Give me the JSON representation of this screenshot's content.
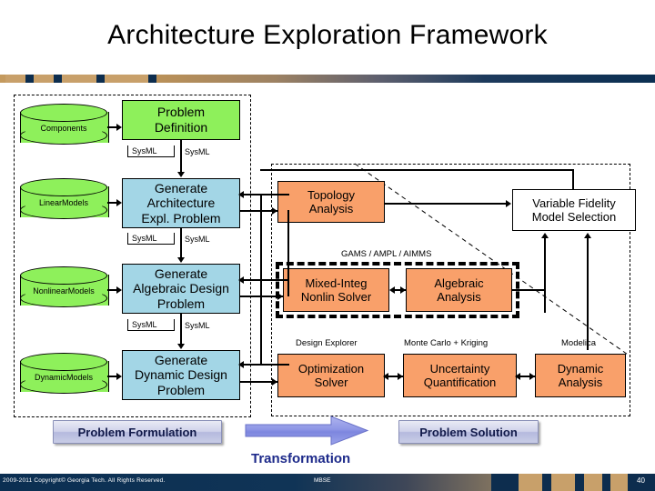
{
  "slide": {
    "title": "Architecture Exploration Framework",
    "footer": {
      "copyright": "2009-2011 Copyright© Georgia Tech. All Rights Reserved.",
      "center": "MBSE",
      "page_number": "40"
    }
  },
  "colors": {
    "green": "#8ef05b",
    "blue": "#a3d6e6",
    "orange": "#f9a06a",
    "white": "#ffffff",
    "navy": "#0d2d4e",
    "tan": "#c8a06a",
    "callout_text": "#121a4a",
    "transformation_text": "#1d2a8a"
  },
  "data_stores": [
    {
      "label": "Components"
    },
    {
      "label": "Linear\nModels",
      "line1": "Linear",
      "line2": "Models"
    },
    {
      "label": "Nonlinear\nModels",
      "line1": "Nonlinear",
      "line2": "Models"
    },
    {
      "label": "Dynamic\nModels",
      "line1": "Dynamic",
      "line2": "Models"
    }
  ],
  "formulation": {
    "problem_definition": {
      "line1": "Problem",
      "line2": "Definition"
    },
    "generate_architecture": {
      "line1": "Generate",
      "line2": "Architecture",
      "line3": "Expl. Problem"
    },
    "generate_algebraic": {
      "line1": "Generate",
      "line2": "Algebraic Design",
      "line3": "Problem"
    },
    "generate_dynamic": {
      "line1": "Generate",
      "line2": "Dynamic Design",
      "line3": "Problem"
    },
    "edge_labels": {
      "pd_to_arch_left": "SysML",
      "pd_to_arch_right": "SysML",
      "arch_to_alg_left": "SysML",
      "arch_to_alg_right": "SysML",
      "alg_to_dyn_left": "SysML",
      "alg_to_dyn_right": "SysML"
    }
  },
  "solution": {
    "topology_analysis": {
      "line1": "Topology",
      "line2": "Analysis"
    },
    "mixed_integer": {
      "line1": "Mixed-Integ",
      "line2": "Nonlin Solver"
    },
    "algebraic_analysis": {
      "line1": "Algebraic",
      "line2": "Analysis"
    },
    "optimization_solver": {
      "line1": "Optimization",
      "line2": "Solver"
    },
    "uncertainty_quantification": {
      "line1": "Uncertainty",
      "line2": "Quantification"
    },
    "dynamic_analysis": {
      "line1": "Dynamic",
      "line2": "Analysis"
    },
    "variable_fidelity": {
      "line1": "Variable Fidelity",
      "line2": "Model Selection"
    },
    "tool_labels": {
      "gams": "GAMS / AMPL / AIMMS",
      "design_explorer": "Design Explorer",
      "monte_carlo": "Monte Carlo + Kriging",
      "modelica": "Modelica"
    }
  },
  "callouts": {
    "problem_formulation": "Problem Formulation",
    "problem_solution": "Problem Solution",
    "transformation": "Transformation"
  }
}
